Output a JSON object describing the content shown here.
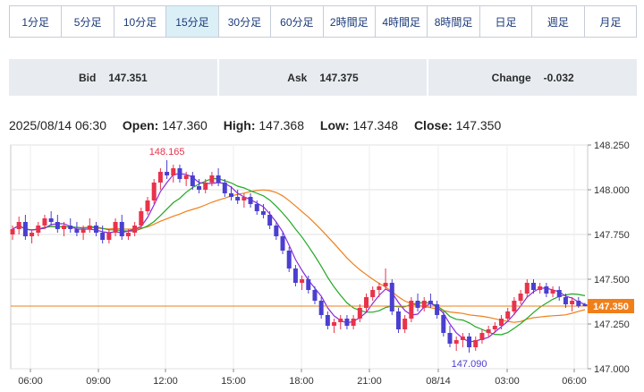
{
  "tabs": [
    {
      "label": "1分足",
      "active": false
    },
    {
      "label": "5分足",
      "active": false
    },
    {
      "label": "10分足",
      "active": false
    },
    {
      "label": "15分足",
      "active": true
    },
    {
      "label": "30分足",
      "active": false
    },
    {
      "label": "60分足",
      "active": false
    },
    {
      "label": "2時間足",
      "active": false
    },
    {
      "label": "4時間足",
      "active": false
    },
    {
      "label": "8時間足",
      "active": false
    },
    {
      "label": "日足",
      "active": false
    },
    {
      "label": "週足",
      "active": false
    },
    {
      "label": "月足",
      "active": false
    }
  ],
  "quotes": {
    "bid_label": "Bid",
    "bid": "147.351",
    "ask_label": "Ask",
    "ask": "147.375",
    "change_label": "Change",
    "change": "-0.032"
  },
  "ohlc": {
    "datetime": "2025/08/14 06:30",
    "open_label": "Open:",
    "open": "147.360",
    "high_label": "High:",
    "high": "147.368",
    "low_label": "Low:",
    "low": "147.348",
    "close_label": "Close:",
    "close": "147.350"
  },
  "colors": {
    "up": "#e8334a",
    "down": "#4a3fd0",
    "ma_short": "#8a2be2",
    "ma_mid": "#22a722",
    "ma_long": "#f07f1a",
    "price_line": "#f07f1a"
  },
  "chart_data": {
    "type": "candlestick",
    "ylim": [
      147.0,
      148.25
    ],
    "yticks": [
      "147.000",
      "147.250",
      "147.500",
      "147.750",
      "148.000",
      "148.250"
    ],
    "xticks": [
      "06:00",
      "09:00",
      "12:00",
      "15:00",
      "18:00",
      "21:00",
      "08/14",
      "03:00",
      "06:00"
    ],
    "current_price": "147.350",
    "annotations": {
      "high": "148.165",
      "low": "147.090"
    },
    "grid": true,
    "candles": [
      [
        147.75,
        147.8,
        147.72,
        147.78
      ],
      [
        147.78,
        147.85,
        147.75,
        147.82
      ],
      [
        147.82,
        147.86,
        147.72,
        147.74
      ],
      [
        147.74,
        147.78,
        147.7,
        147.76
      ],
      [
        147.76,
        147.82,
        147.74,
        147.8
      ],
      [
        147.8,
        147.86,
        147.78,
        147.84
      ],
      [
        147.84,
        147.88,
        147.8,
        147.82
      ],
      [
        147.82,
        147.86,
        147.76,
        147.78
      ],
      [
        147.78,
        147.82,
        147.74,
        147.8
      ],
      [
        147.8,
        147.84,
        147.76,
        147.78
      ],
      [
        147.78,
        147.82,
        147.74,
        147.76
      ],
      [
        147.76,
        147.8,
        147.72,
        147.78
      ],
      [
        147.78,
        147.84,
        147.76,
        147.8
      ],
      [
        147.8,
        147.82,
        147.74,
        147.76
      ],
      [
        147.76,
        147.8,
        147.7,
        147.72
      ],
      [
        147.72,
        147.78,
        147.7,
        147.76
      ],
      [
        147.76,
        147.84,
        147.74,
        147.82
      ],
      [
        147.82,
        147.86,
        147.72,
        147.74
      ],
      [
        147.74,
        147.78,
        147.72,
        147.76
      ],
      [
        147.76,
        147.82,
        147.74,
        147.8
      ],
      [
        147.8,
        147.9,
        147.78,
        147.88
      ],
      [
        147.88,
        147.96,
        147.86,
        147.94
      ],
      [
        147.94,
        148.06,
        147.92,
        148.04
      ],
      [
        148.04,
        148.12,
        148.0,
        148.1
      ],
      [
        148.1,
        148.165,
        148.06,
        148.08
      ],
      [
        148.08,
        148.14,
        148.04,
        148.12
      ],
      [
        148.12,
        148.14,
        148.04,
        148.06
      ],
      [
        148.06,
        148.1,
        148.02,
        148.08
      ],
      [
        148.08,
        148.1,
        148.0,
        148.02
      ],
      [
        148.02,
        148.06,
        147.98,
        148.0
      ],
      [
        148.0,
        148.06,
        147.98,
        148.04
      ],
      [
        148.04,
        148.1,
        148.02,
        148.08
      ],
      [
        148.08,
        148.12,
        148.02,
        148.04
      ],
      [
        148.04,
        148.06,
        147.96,
        147.98
      ],
      [
        147.98,
        148.02,
        147.94,
        147.96
      ],
      [
        147.96,
        148.0,
        147.92,
        147.94
      ],
      [
        147.94,
        147.98,
        147.9,
        147.96
      ],
      [
        147.96,
        147.98,
        147.9,
        147.92
      ],
      [
        147.92,
        147.94,
        147.86,
        147.88
      ],
      [
        147.88,
        147.92,
        147.84,
        147.86
      ],
      [
        147.86,
        147.88,
        147.78,
        147.8
      ],
      [
        147.8,
        147.82,
        147.72,
        147.74
      ],
      [
        147.74,
        147.76,
        147.64,
        147.66
      ],
      [
        147.66,
        147.68,
        147.54,
        147.56
      ],
      [
        147.56,
        147.58,
        147.46,
        147.48
      ],
      [
        147.48,
        147.52,
        147.44,
        147.5
      ],
      [
        147.5,
        147.52,
        147.42,
        147.44
      ],
      [
        147.44,
        147.46,
        147.36,
        147.38
      ],
      [
        147.38,
        147.4,
        147.28,
        147.3
      ],
      [
        147.3,
        147.32,
        147.22,
        147.24
      ],
      [
        147.24,
        147.28,
        147.2,
        147.26
      ],
      [
        147.26,
        147.3,
        147.22,
        147.28
      ],
      [
        147.28,
        147.3,
        147.22,
        147.24
      ],
      [
        147.24,
        147.3,
        147.22,
        147.28
      ],
      [
        147.28,
        147.36,
        147.26,
        147.34
      ],
      [
        147.34,
        147.42,
        147.32,
        147.4
      ],
      [
        147.4,
        147.46,
        147.38,
        147.44
      ],
      [
        147.44,
        147.48,
        147.4,
        147.46
      ],
      [
        147.46,
        147.56,
        147.44,
        147.48
      ],
      [
        147.48,
        147.5,
        147.3,
        147.32
      ],
      [
        147.32,
        147.34,
        147.2,
        147.22
      ],
      [
        147.22,
        147.3,
        147.2,
        147.28
      ],
      [
        147.28,
        147.4,
        147.26,
        147.38
      ],
      [
        147.38,
        147.42,
        147.32,
        147.34
      ],
      [
        147.34,
        147.4,
        147.32,
        147.38
      ],
      [
        147.38,
        147.42,
        147.34,
        147.36
      ],
      [
        147.36,
        147.38,
        147.28,
        147.3
      ],
      [
        147.3,
        147.32,
        147.18,
        147.2
      ],
      [
        147.2,
        147.24,
        147.12,
        147.14
      ],
      [
        147.14,
        147.18,
        147.1,
        147.16
      ],
      [
        147.16,
        147.2,
        147.12,
        147.18
      ],
      [
        147.18,
        147.2,
        147.09,
        147.12
      ],
      [
        147.12,
        147.18,
        147.1,
        147.16
      ],
      [
        147.16,
        147.22,
        147.14,
        147.2
      ],
      [
        147.2,
        147.24,
        147.18,
        147.22
      ],
      [
        147.22,
        147.26,
        147.2,
        147.24
      ],
      [
        147.24,
        147.3,
        147.22,
        147.28
      ],
      [
        147.28,
        147.34,
        147.26,
        147.32
      ],
      [
        147.32,
        147.4,
        147.3,
        147.38
      ],
      [
        147.38,
        147.44,
        147.36,
        147.42
      ],
      [
        147.42,
        147.5,
        147.4,
        147.48
      ],
      [
        147.48,
        147.5,
        147.42,
        147.44
      ],
      [
        147.44,
        147.48,
        147.42,
        147.46
      ],
      [
        147.46,
        147.48,
        147.4,
        147.42
      ],
      [
        147.42,
        147.46,
        147.4,
        147.44
      ],
      [
        147.44,
        147.46,
        147.38,
        147.4
      ],
      [
        147.4,
        147.42,
        147.34,
        147.36
      ],
      [
        147.36,
        147.4,
        147.32,
        147.38
      ],
      [
        147.38,
        147.4,
        147.34,
        147.35
      ],
      [
        147.36,
        147.368,
        147.348,
        147.35
      ]
    ]
  }
}
